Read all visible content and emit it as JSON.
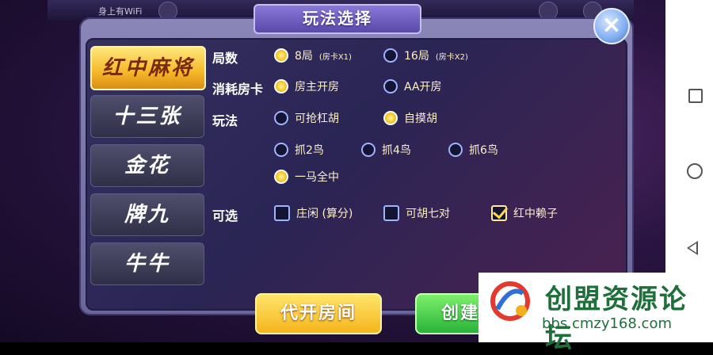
{
  "status_bar": {
    "wifi_label": "身上有WiFi"
  },
  "dialog": {
    "title": "玩法选择",
    "close_icon": "close-icon"
  },
  "tabs": [
    {
      "label": "红中麻将",
      "active": true
    },
    {
      "label": "十三张",
      "active": false
    },
    {
      "label": "金花",
      "active": false
    },
    {
      "label": "牌九",
      "active": false
    },
    {
      "label": "牛牛",
      "active": false
    }
  ],
  "rows": {
    "rounds": {
      "label": "局数",
      "options": [
        {
          "label": "8局",
          "note": "(房卡X1)",
          "selected": true
        },
        {
          "label": "16局",
          "note": "(房卡X2)",
          "selected": false
        }
      ]
    },
    "card_cost": {
      "label": "消耗房卡",
      "options": [
        {
          "label": "房主开房",
          "selected": true
        },
        {
          "label": "AA开房",
          "selected": false
        }
      ]
    },
    "play": {
      "label": "玩法",
      "options": [
        {
          "label": "可抢杠胡",
          "selected": false
        },
        {
          "label": "自摸胡",
          "selected": true
        },
        {
          "label": "抓2鸟",
          "selected": false
        },
        {
          "label": "抓4鸟",
          "selected": false
        },
        {
          "label": "抓6鸟",
          "selected": false
        },
        {
          "label": "一马全中",
          "selected": true
        }
      ]
    },
    "optional": {
      "label": "可选",
      "options": [
        {
          "label": "庄闲 (算分)",
          "checked": false
        },
        {
          "label": "可胡七对",
          "checked": false
        },
        {
          "label": "红中赖子",
          "checked": true
        }
      ]
    }
  },
  "buttons": {
    "proxy_open": "代开房间",
    "create": "创建"
  },
  "watermark": {
    "title": "创盟资源论坛",
    "url": "bbs.cmzy168.com"
  }
}
